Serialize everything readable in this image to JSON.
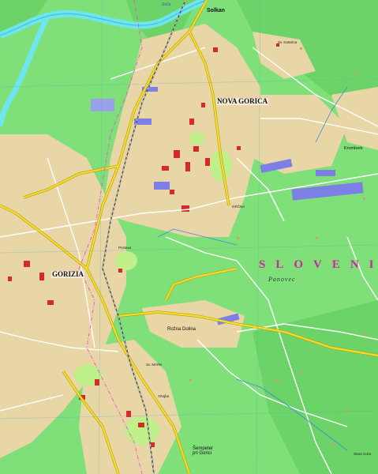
{
  "map": {
    "country_label": "SLOVENIJA",
    "places": {
      "solkan": "Solkan",
      "nova_gorica": "NOVA GORICA",
      "gorizia": "GORIZIA",
      "rozna_dolina": "Rožna Dolina",
      "sempeter": "Šempeter\npri Gorici",
      "panovec": "Panovec",
      "kromberk": "Kromberk",
      "stara_gora": "Stara Gora",
      "grcna": "GRČNA",
      "pristava": "Pristava",
      "st_katarina": "Sv. Katarina",
      "st_mark": "Sv. MARK",
      "vrtojba_label": "Vrtojba",
      "river": "Soča"
    },
    "colors": {
      "land": "#7fe07a",
      "urban": "#e8d6a6",
      "river": "#6fe6ec",
      "road_major": "#f5dd2a",
      "road_local": "#ffffff",
      "building": "#d42a2a",
      "industry": "#7b7fe6",
      "park": "#bff08a",
      "country_label": "#c8299a",
      "border": "#ff3ad0"
    }
  }
}
